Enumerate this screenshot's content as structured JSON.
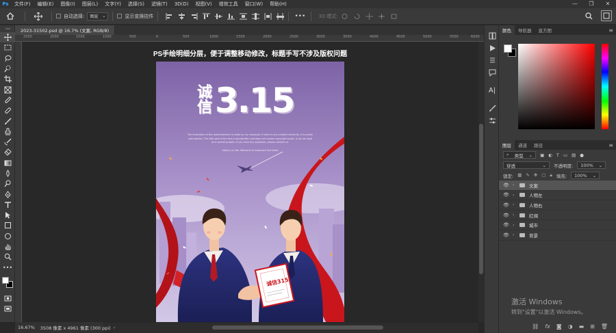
{
  "menubar": {
    "logo": "Ps",
    "items": [
      "文件(F)",
      "编辑(E)",
      "图像(I)",
      "图层(L)",
      "文字(Y)",
      "选择(S)",
      "滤镜(T)",
      "3D(D)",
      "视图(V)",
      "增效工具",
      "窗口(W)",
      "帮助(H)"
    ],
    "minimize": "—",
    "maximize": "❐",
    "close": "✕"
  },
  "options": {
    "auto_select_label": "自动选择:",
    "auto_select_value": "图层",
    "show_transform_label": "显示变换控件",
    "more": "•••",
    "mode3d": "3D 模式:"
  },
  "document": {
    "tab_title": "2023-31502.psd @ 16.7% (文案, RGB/8)",
    "tab_close": "×",
    "ruler_ticks": [
      "2500",
      "2000",
      "1500",
      "1000",
      "500",
      "0",
      "500",
      "1000",
      "1500",
      "2000",
      "2500",
      "3000",
      "3500",
      "4000",
      "4500",
      "5000",
      "5500",
      "6000"
    ],
    "caption": "PS手绘明细分层，便于调整移动修改，标题手写不涉及版权问题",
    "poster": {
      "title_small_1": "诚",
      "title_small_2": "信",
      "title_number": "3.15",
      "blurb": "The illustration of this advertisement is made by my computer. If there is any creative similarity, it is purely coincidental. This title part of the text is handwritten and does not involve copyright issues. It can be used as a normal graphic. If you have any questions, please contact us.",
      "subline": "Gallery on site. Welcome to download and share",
      "certificate_text": "诚信315"
    }
  },
  "status": {
    "zoom": "16.67%",
    "dims": "3508 像素 x 4961 像素 (300 ppi)",
    "arrow": "›"
  },
  "panels": {
    "color_tabs": [
      "颜色",
      "导航器",
      "直方图"
    ],
    "layers_tabs": [
      "图层",
      "通道",
      "路径"
    ],
    "kind_label": "类型",
    "blend_mode": "穿透",
    "opacity_label": "不透明度:",
    "opacity_value": "100%",
    "lock_label": "锁定:",
    "fill_label": "填充:",
    "fill_value": "100%",
    "layers": [
      "文案",
      "人物左",
      "人物右",
      "红绸",
      "城市",
      "背景"
    ],
    "selected_layer": 0,
    "watermark_line1": "激活 Windows",
    "watermark_line2": "转到\"设置\"以激活 Windows。",
    "footer_icons": [
      "link-icon",
      "fx-icon",
      "mask-icon",
      "adjustment-icon",
      "group-icon",
      "new-layer-icon",
      "trash-icon"
    ]
  },
  "colors": {
    "accent": "#31a8ff",
    "poster_bg_top": "#7d63a6",
    "ribbon_red": "#c9161d",
    "suit_navy": "#23286b"
  }
}
